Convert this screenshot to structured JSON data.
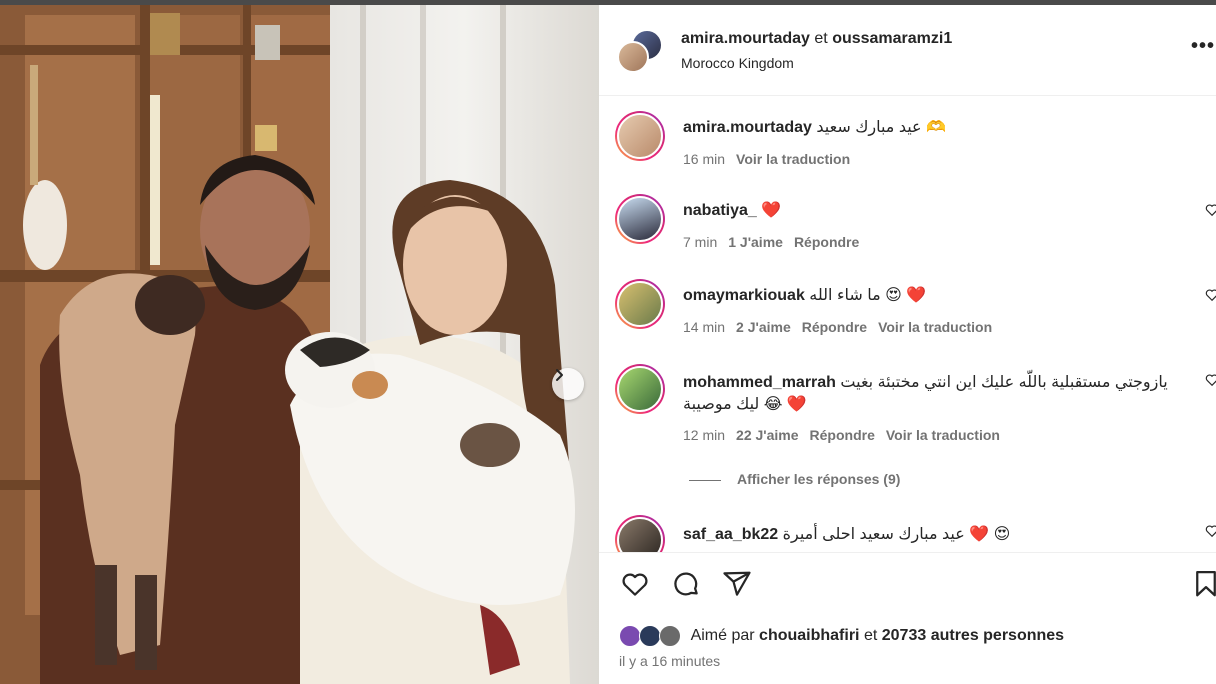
{
  "post": {
    "header": {
      "author": "amira.mourtaday",
      "joiner": "et",
      "coauthor": "oussamaramzi1",
      "location": "Morocco Kingdom",
      "more_icon": "more-horizontal-icon"
    },
    "comments": [
      {
        "user": "amira.mourtaday",
        "text": "عيد مبارك سعيد 🫶",
        "time": "16 min",
        "likes": "",
        "reply": "",
        "translate": "Voir la traduction"
      },
      {
        "user": "nabatiya_",
        "text": "❤️",
        "time": "7 min",
        "likes": "1 J'aime",
        "reply": "Répondre",
        "translate": ""
      },
      {
        "user": "omaymarkiouak",
        "text": "ما شاء الله 😍 ❤️",
        "time": "14 min",
        "likes": "2 J'aime",
        "reply": "Répondre",
        "translate": "Voir la traduction"
      },
      {
        "user": "mohammed_marrah",
        "text": "يازوجتي مستقبلية باللّه عليك اين انتي مختبئة بغيت ليك موصيبة 😂 ❤️",
        "time": "12 min",
        "likes": "22 J'aime",
        "reply": "Répondre",
        "translate": "Voir la traduction"
      },
      {
        "user": "saf_aa_bk22",
        "text": "عيد مبارك سعيد احلى أميرة ❤️ 😍",
        "time": "",
        "likes": "",
        "reply": "",
        "translate": ""
      }
    ],
    "show_replies": "Afficher les réponses (9)",
    "liked_by": {
      "prefix": "Aimé par",
      "user": "chouaibhafiri",
      "joiner": "et",
      "others": "20733 autres personnes"
    },
    "time_ago": "il y a 16 minutes"
  },
  "colors": {
    "text": "#262626",
    "secondary": "#737373",
    "story_ring": [
      "#f9ce34",
      "#ee2a7b",
      "#962fbf"
    ],
    "heart": "#e0245e"
  },
  "icons": [
    "heart-icon",
    "comment-icon",
    "share-icon",
    "bookmark-icon",
    "next-arrow-icon"
  ]
}
